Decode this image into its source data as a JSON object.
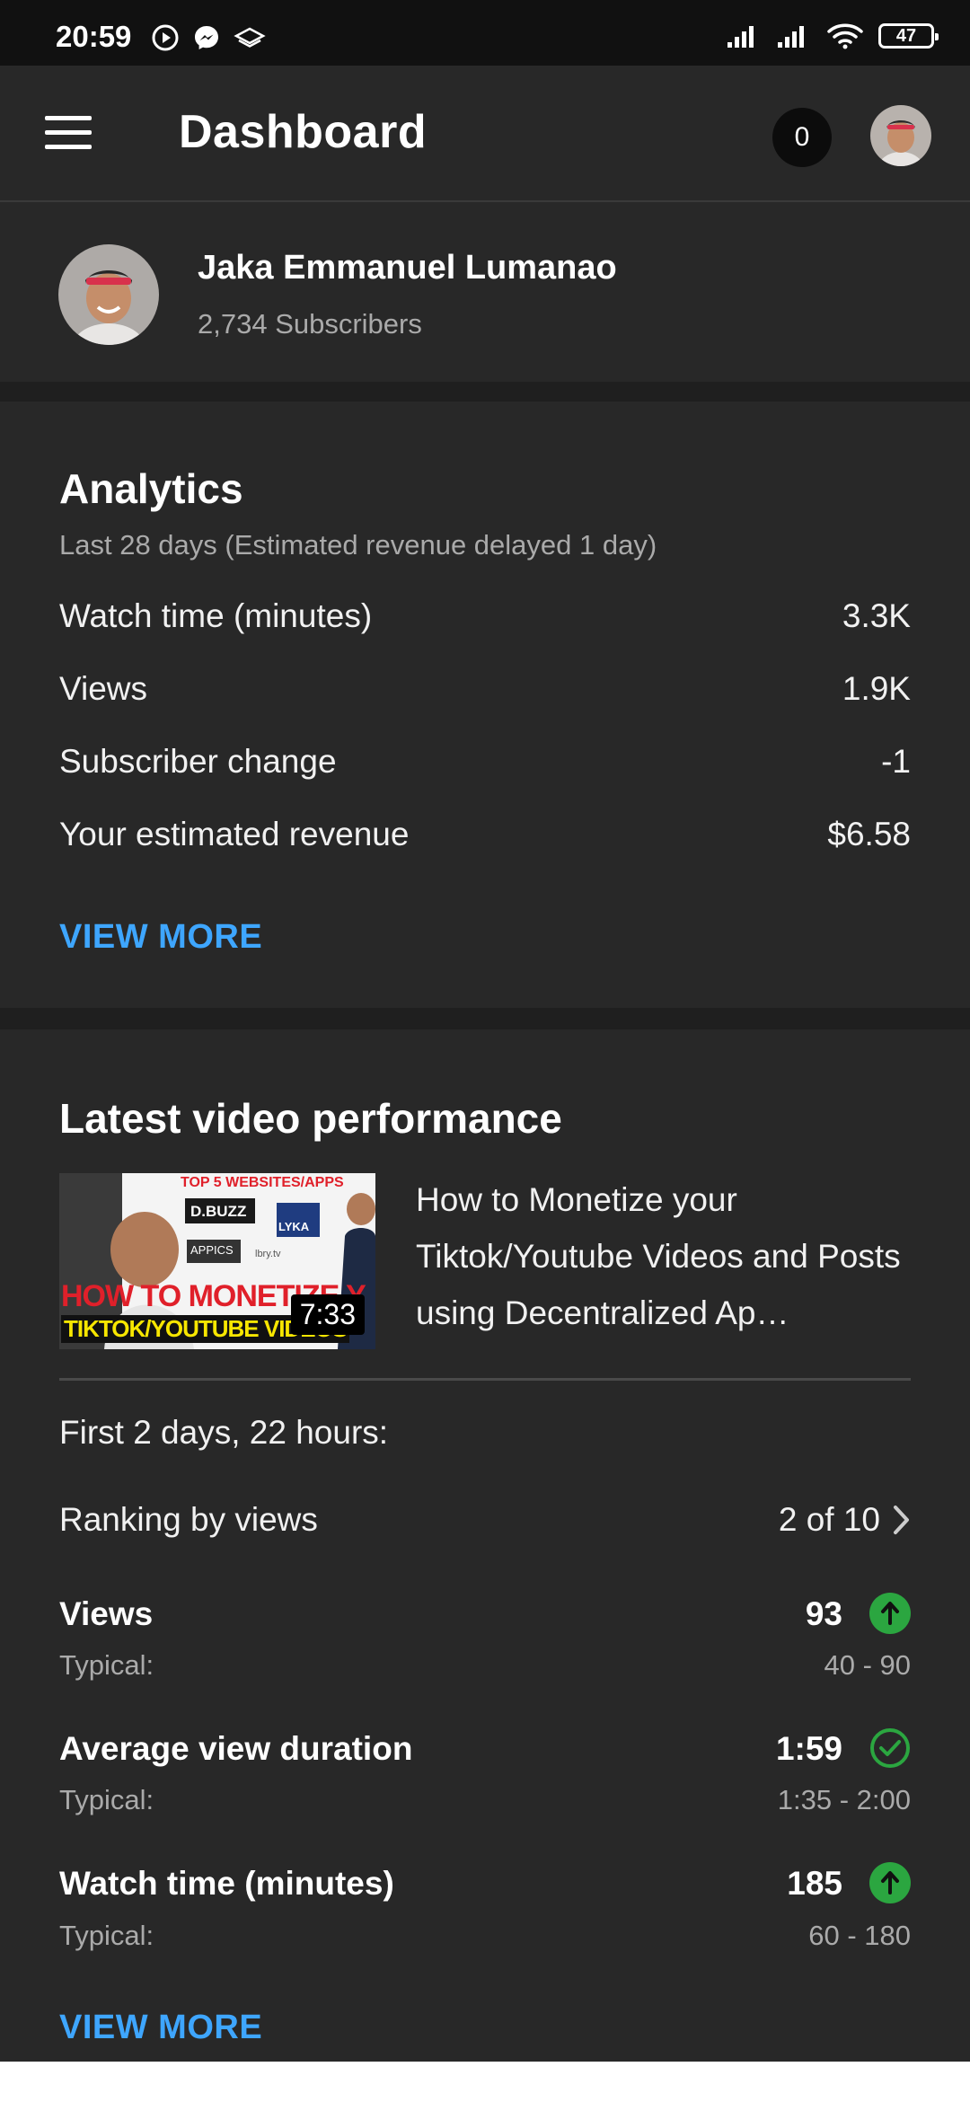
{
  "status_bar": {
    "time": "20:59",
    "battery": "47",
    "icons": [
      "play-circle-icon",
      "messenger-icon",
      "layers-icon",
      "signal-icon",
      "signal-icon",
      "wifi-icon",
      "battery-icon"
    ]
  },
  "header": {
    "title": "Dashboard",
    "notification_count": "0"
  },
  "channel": {
    "name": "Jaka Emmanuel Lumanao",
    "subscribers": "2,734 Subscribers"
  },
  "analytics": {
    "title": "Analytics",
    "subtitle": "Last 28 days (Estimated revenue delayed 1 day)",
    "rows": [
      {
        "label": "Watch time (minutes)",
        "value": "3.3K"
      },
      {
        "label": "Views",
        "value": "1.9K"
      },
      {
        "label": "Subscriber change",
        "value": "-1"
      },
      {
        "label": "Your estimated revenue",
        "value": "$6.58"
      }
    ],
    "view_more": "VIEW MORE"
  },
  "latest": {
    "title": "Latest video performance",
    "video": {
      "title": "How to Monetize your Tiktok/Youtube Videos and Posts using Decentralized Ap…",
      "duration": "7:33",
      "thumb_text_top": "TOP 5 WEBSITES/APPS",
      "thumb_text_main": "HOW TO MONETIZE Y",
      "thumb_text_bottom": "TIKTOK/YOUTUBE VIDEOS",
      "thumb_logo_1": "D.BUZZ",
      "thumb_logo_2": "LYKA",
      "thumb_logo_3": "APPICS",
      "thumb_logo_4": "lbry.tv"
    },
    "period": "First 2 days, 22 hours:",
    "ranking": {
      "label": "Ranking by views",
      "value": "2 of 10"
    },
    "metrics": [
      {
        "label": "Views",
        "value": "93",
        "typical_label": "Typical:",
        "typical": "40 - 90",
        "icon": "arrow-up-icon"
      },
      {
        "label": "Average view duration",
        "value": "1:59",
        "typical_label": "Typical:",
        "typical": "1:35 - 2:00",
        "icon": "check-circle-icon"
      },
      {
        "label": "Watch time (minutes)",
        "value": "185",
        "typical_label": "Typical:",
        "typical": "60 - 180",
        "icon": "arrow-up-icon"
      }
    ],
    "view_more": "VIEW MORE"
  },
  "colors": {
    "background": "#1f1f1f",
    "card": "#282828",
    "link": "#3ea6ff",
    "good": "#2ba640",
    "secondary_text": "#aaaaaa"
  }
}
